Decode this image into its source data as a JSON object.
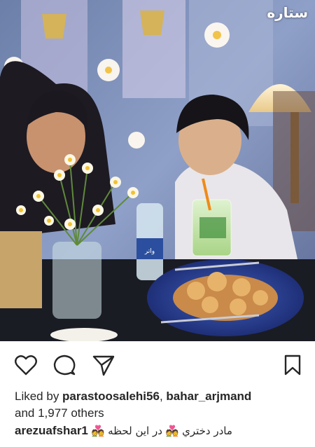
{
  "post": {
    "watermark": "ستاره",
    "likes_prefix": "Liked by ",
    "liked_user_1": "parastoosalehi56",
    "likes_separator": ", ",
    "liked_user_2": "bahar_arjmand",
    "likes_suffix_line2": "and 1,977 others",
    "caption_user": "arezuafshar1",
    "caption_text": "مادر دختري 💑 در اين لحظه 💑",
    "bottle_label": "واتر"
  },
  "icons": {
    "like": "heart-icon",
    "comment": "comment-icon",
    "share": "send-icon",
    "save": "bookmark-icon"
  },
  "colors": {
    "text": "#262626",
    "background": "#ffffff"
  }
}
